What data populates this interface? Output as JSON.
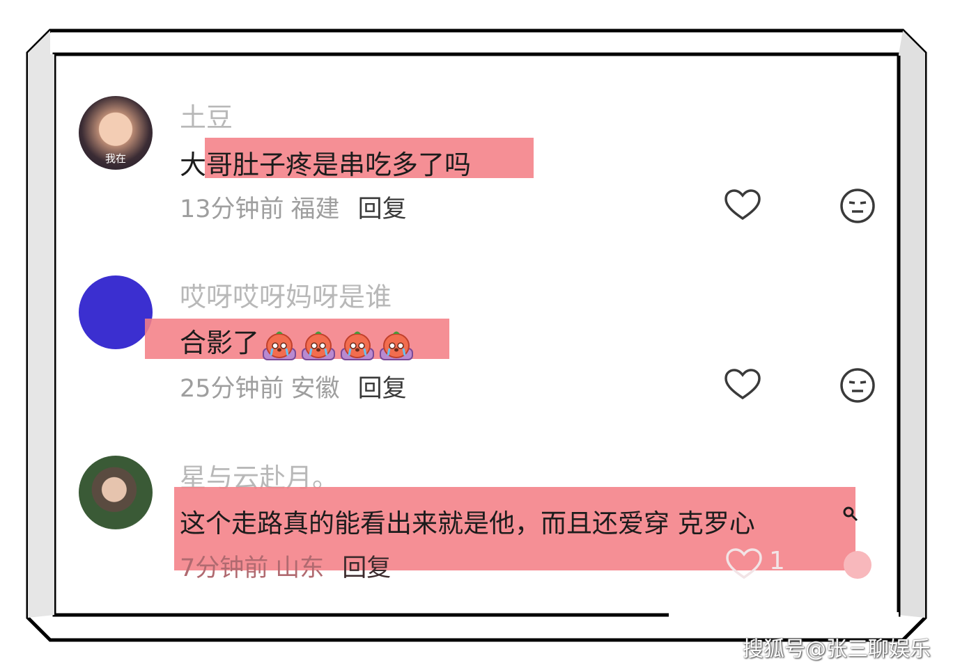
{
  "comments": [
    {
      "username": "土豆",
      "avatar_caption": "我在",
      "text": "大哥肚子疼是串吃多了吗",
      "time": "13分钟前",
      "location": "福建",
      "reply_label": "回复"
    },
    {
      "username": "哎呀哎呀妈呀是谁",
      "text": "合影了",
      "emoji_count": 4,
      "time": "25分钟前",
      "location": "安徽",
      "reply_label": "回复"
    },
    {
      "username": "星与云赴月。",
      "text": "这个走路真的能看出来就是他，而且还爱穿 克罗心",
      "time": "7分钟前",
      "location": "山东",
      "reply_label": "回复",
      "like_count": "1"
    }
  ],
  "watermark": "搜狐号@张三聊娱乐",
  "icons": {
    "like": "heart-icon",
    "dislike": "neutral-face-icon",
    "search": "search-icon",
    "emoji": "crying-sticker-icon"
  },
  "colors": {
    "highlight": "#f47f86",
    "username": "#b8b8b8",
    "meta": "#9e9e9e",
    "avatar_blue": "#3b2fd0"
  }
}
